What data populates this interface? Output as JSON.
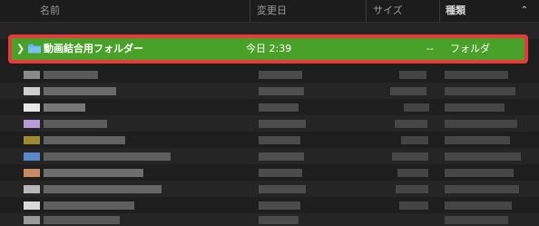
{
  "columns": {
    "name": "名前",
    "date": "変更日",
    "size": "サイズ",
    "kind": "種類"
  },
  "selected_row": {
    "name": "動画結合用フォルダー",
    "date": "今日 2:39",
    "size": "--",
    "kind": "フォルダ"
  },
  "colors": {
    "selection": "#4aa12a",
    "annotation_border": "#e8393d",
    "folder_icon": "#5fb0ee"
  },
  "icons": [
    "disclosure-chevron-icon",
    "folder-icon",
    "sort-chevron-icon"
  ],
  "obscured_rows": 9
}
